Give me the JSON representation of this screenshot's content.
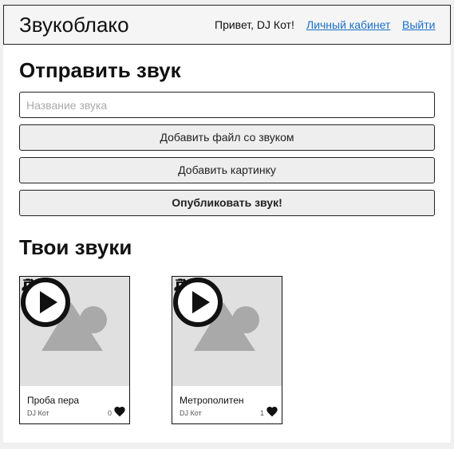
{
  "header": {
    "brand": "Звукоблако",
    "greeting": "Привет, DJ Кот!",
    "cabinet_link": "Личный кабинет",
    "logout_link": "Выйти"
  },
  "upload": {
    "title": "Отправить звук",
    "name_placeholder": "Название звука",
    "name_value": "",
    "add_file_label": "Добавить файл со звуком",
    "add_image_label": "Добавить картинку",
    "publish_label": "Опубликовать звук!"
  },
  "sounds": {
    "title": "Твои звуки",
    "items": [
      {
        "title": "Проба пера",
        "author": "DJ Кот",
        "likes": "0",
        "icon": "heart-icon"
      },
      {
        "title": "Метрополитен",
        "author": "DJ Кот",
        "likes": "1",
        "icon": "heart-icon"
      }
    ]
  },
  "colors": {
    "link": "#1a6fc8",
    "header_bg": "#f5f5f5",
    "button_bg": "#eeeeee",
    "cover_bg": "#e0e0e0",
    "cover_shape": "#a9a9a9"
  }
}
